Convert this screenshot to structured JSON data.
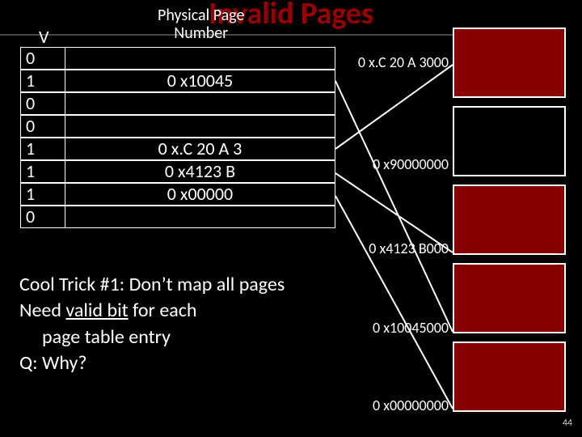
{
  "title": "Invalid Pages",
  "header": {
    "physical_label_line1": "Physical Page",
    "physical_label_line2": "Number",
    "v_label": "V"
  },
  "table": {
    "rows": [
      {
        "v": "0",
        "p": ""
      },
      {
        "v": "1",
        "p": "0 x10045"
      },
      {
        "v": "0",
        "p": ""
      },
      {
        "v": "0",
        "p": ""
      },
      {
        "v": "1",
        "p": "0 x.C 20 A 3"
      },
      {
        "v": "1",
        "p": "0 x4123 B"
      },
      {
        "v": "1",
        "p": "0 x00000"
      },
      {
        "v": "0",
        "p": ""
      }
    ]
  },
  "addresses": {
    "a0": "0 x.C 20 A 3000",
    "a1": "0 x90000000",
    "a2": "0 x4123 B000",
    "a3": "0 x10045000",
    "a4": "0 x00000000"
  },
  "body": {
    "line1": "Cool Trick #1: Don’t map all pages",
    "line2a": "Need ",
    "line2b": "valid bit",
    "line2c": " for each",
    "line3": "page table entry",
    "line4": "Q: Why?"
  },
  "slide_number": "44"
}
